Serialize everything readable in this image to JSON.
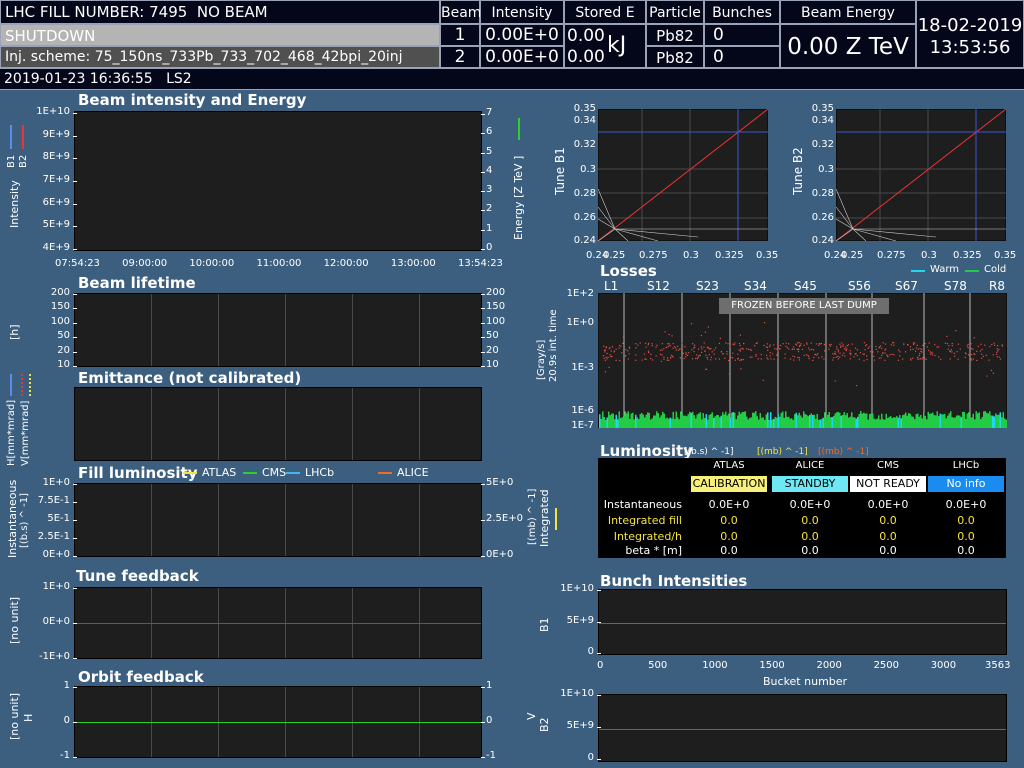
{
  "header": {
    "fill_label": "LHC FILL NUMBER:",
    "fill_number": "7495",
    "fill_state": "NO BEAM",
    "mode": "SHUTDOWN",
    "inj_scheme": "Inj. scheme: 75_150ns_733Pb_733_702_468_42bpi_20inj",
    "datetime_left": "2019-01-23  16:36:55",
    "period": "LS2",
    "col_beam": "Beam",
    "col_intensity": "Intensity",
    "col_stored": "Stored E",
    "col_particle": "Particle",
    "col_bunches": "Bunches",
    "col_energy": "Beam Energy",
    "beam1": "1",
    "beam2": "2",
    "int1": "0.00E+0",
    "int2": "0.00E+0",
    "stored1": "0.00",
    "stored2": "0.00",
    "stored_unit": "kJ",
    "part1": "Pb82",
    "part2": "Pb82",
    "bunch1": "0",
    "bunch2": "0",
    "energy_value": "0.00 Z TeV",
    "date": "18-02-2019",
    "time": "13:53:56"
  },
  "intensity_panel": {
    "title": "Beam intensity and Energy",
    "ylabel": "Intensity",
    "y2label": "Energy [Z TeV ]",
    "b1": "B1",
    "b2": "B2",
    "yticks": [
      "1E+10",
      "9E+9",
      "8E+9",
      "7E+9",
      "6E+9",
      "5E+9",
      "4E+9"
    ],
    "y2ticks": [
      "7",
      "6",
      "5",
      "4",
      "3",
      "2",
      "1",
      "0"
    ],
    "xticks": [
      "07:54:23",
      "09:00:00",
      "10:00:00",
      "11:00:00",
      "12:00:00",
      "13:00:00",
      "13:54:23"
    ]
  },
  "lifetime_panel": {
    "title": "Beam lifetime",
    "ylabel": "[h]",
    "yticks": [
      "200",
      "150",
      "100",
      "50",
      "20",
      "10"
    ],
    "y2ticks": [
      "200",
      "150",
      "100",
      "50",
      "20",
      "10"
    ]
  },
  "emittance_panel": {
    "title": "Emittance (not calibrated)",
    "ylabel1": "H[mm*mrad]",
    "ylabel2": "V[mm*mrad]"
  },
  "fill_lumi_panel": {
    "title": "Fill luminosity",
    "legend": [
      {
        "name": "ATLAS",
        "color": "#f5e43a"
      },
      {
        "name": "CMS",
        "color": "#2bd12b"
      },
      {
        "name": "LHCb",
        "color": "#46b4f0"
      },
      {
        "name": "ALICE",
        "color": "#f06a2c"
      }
    ],
    "ylabel": "Instantaneous",
    "ylabel_unit": "[(b.s) ^ -1]",
    "y2label": "Integrated",
    "y2label_unit": "[(mb) ^ -1]",
    "yticks": [
      "1E+0",
      "7.5E-1",
      "5E-1",
      "2.5E-1",
      "0E+0"
    ],
    "y2ticks": [
      "5E+0",
      "2.5E+0",
      "0E+0"
    ]
  },
  "tune_feedback_panel": {
    "title": "Tune feedback",
    "ylabel": "[no unit]",
    "yticks": [
      "1E+0",
      "0E+0",
      "-1E+0"
    ]
  },
  "orbit_feedback_panel": {
    "title": "Orbit feedback",
    "ylabel": "[no unit]",
    "hlabel": "H",
    "yticks": [
      "1",
      "0",
      "-1"
    ],
    "y2ticks": [
      "1",
      "0",
      "-1"
    ]
  },
  "tune_b1": {
    "ylabel": "Tune B1",
    "yticks": [
      "0.35",
      "0.34",
      "0.32",
      "0.3",
      "0.28",
      "0.26",
      "0.24"
    ],
    "xticks": [
      "0.24",
      "0.25",
      "0.275",
      "0.3",
      "0.325",
      "0.35"
    ]
  },
  "tune_b2": {
    "ylabel": "Tune B2",
    "yticks": [
      "0.35",
      "0.34",
      "0.32",
      "0.3",
      "0.28",
      "0.26",
      "0.24"
    ],
    "xticks": [
      "0.24",
      "0.25",
      "0.275",
      "0.3",
      "0.325",
      "0.35"
    ]
  },
  "losses_panel": {
    "title": "Losses",
    "legend_warm": "Warm",
    "legend_cold": "Cold",
    "warm_color": "#1ed8f0",
    "cold_color": "#22cc44",
    "sectors": [
      "L1",
      "S12",
      "S23",
      "S34",
      "S45",
      "S56",
      "S67",
      "S78",
      "R8"
    ],
    "ylabel": "[Gray/s]",
    "ylabel2": "20.9s int. time",
    "yticks": [
      "1E+2",
      "1E+0",
      "1E-3",
      "1E-6",
      "1E-7"
    ],
    "frozen": "FROZEN BEFORE LAST DUMP"
  },
  "luminosity_table": {
    "title": "Luminosity",
    "unit1": "[(b.s) ^ -1]",
    "unit2": "[(mb) ^ -1]",
    "unit3": "[(mb) ^ -1]",
    "experiments": [
      "ATLAS",
      "ALICE",
      "CMS",
      "LHCb"
    ],
    "statuses": [
      {
        "text": "CALIBRATION",
        "bg": "#f7f07a",
        "fg": "#000"
      },
      {
        "text": "STANDBY",
        "bg": "#6fe8f5",
        "fg": "#000"
      },
      {
        "text": "NOT READY",
        "bg": "#ffffff",
        "fg": "#000"
      },
      {
        "text": "No info",
        "bg": "#1a8cf0",
        "fg": "#fff"
      }
    ],
    "rows": [
      {
        "label": "Instantaneous",
        "values": [
          "0.0E+0",
          "0.0E+0",
          "0.0E+0",
          "0.0E+0"
        ]
      },
      {
        "label": "Integrated fill",
        "values": [
          "0.0",
          "0.0",
          "0.0",
          "0.0"
        ]
      },
      {
        "label": "Integrated/h",
        "values": [
          "0.0",
          "0.0",
          "0.0",
          "0.0"
        ]
      },
      {
        "label": "beta * [m]",
        "values": [
          "0.0",
          "0.0",
          "0.0",
          "0.0"
        ]
      }
    ]
  },
  "bunch_panel": {
    "title": "Bunch Intensities",
    "b1": "B1",
    "b2": "B2",
    "yticks": [
      "1E+10",
      "5E+9",
      "0"
    ],
    "xticks": [
      "0",
      "500",
      "1000",
      "1500",
      "2000",
      "2500",
      "3000",
      "3563"
    ],
    "xlabel": "Bucket number"
  }
}
